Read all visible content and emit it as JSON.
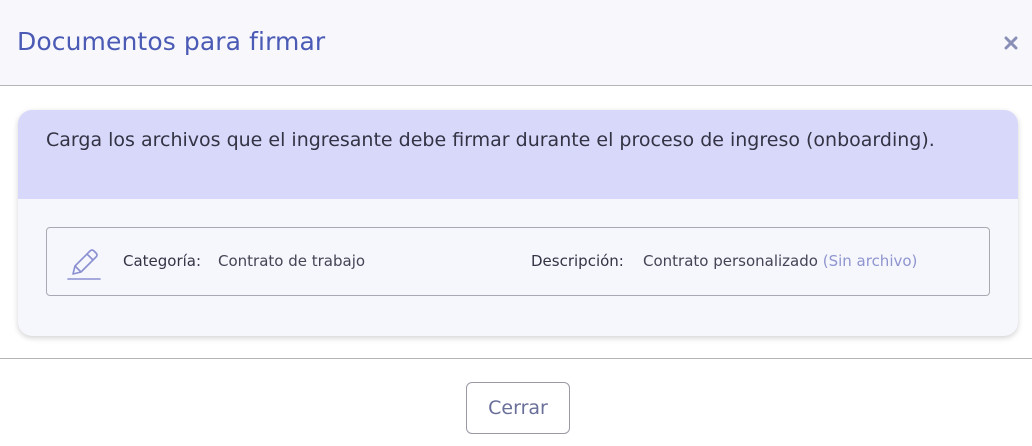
{
  "modal": {
    "title": "Documentos para firmar",
    "close_icon": "close-icon",
    "info_text": "Carga los archivos que el ingresante debe firmar durante el proceso de ingreso (onboarding).",
    "document": {
      "icon": "pencil-icon",
      "category_label": "Categoría:",
      "category_value": "Contrato de trabajo",
      "description_label": "Descripción:",
      "description_value": "Contrato personalizado",
      "file_status": "(Sin archivo)"
    },
    "footer": {
      "close_label": "Cerrar"
    }
  },
  "colors": {
    "title": "#4a5ab5",
    "banner": "#d8d8fb",
    "card": "#f6f6fd",
    "file_status": "#8f95cf"
  }
}
